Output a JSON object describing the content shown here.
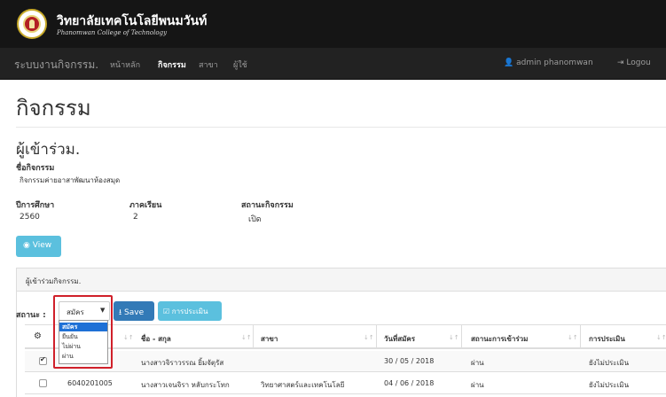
{
  "header": {
    "brand_th": "วิทยาลัยเทคโนโลยีพนมวันท์",
    "brand_en": "Phanomwan College of Technology"
  },
  "navbar": {
    "title": "ระบบงานกิจกรรม.",
    "items": [
      {
        "label": "หน้าหลัก",
        "active": false
      },
      {
        "label": "กิจกรรม",
        "active": true
      },
      {
        "label": "สาขา",
        "active": false
      },
      {
        "label": "ผู้ใช้",
        "active": false
      }
    ],
    "user": "admin phanomwan",
    "logout": "Logou"
  },
  "page": {
    "title": "กิจกรรม",
    "section_title": "ผู้เข้าร่วม.",
    "activity_label": "ชื่อกิจกรรม",
    "activity_value": "กิจกรรมค่ายอาสาพัฒนาห้องสมุด",
    "year_label": "ปีการศึกษา",
    "year_value": "2560",
    "term_label": "ภาคเรียน",
    "term_value": "2",
    "status_label": "สถานะกิจกรรม",
    "status_value": "เปิด",
    "view_button": "View"
  },
  "panel": {
    "heading": "ผู้เข้าร่วมกิจกรรม.",
    "status_label": "สถานะ :",
    "select_value": "สมัคร",
    "dropdown_options": [
      "สมัคร",
      "ยืนยัน",
      "ไม่ผ่าน",
      "ผ่าน"
    ],
    "save_button": "Save",
    "evaluate_button": "การประเมิน"
  },
  "table": {
    "columns": [
      "ชื่อ - สกุล",
      "สาขา",
      "วันที่สมัคร",
      "สถานะการเข้าร่วม",
      "การประเมิน"
    ],
    "rows": [
      {
        "checked": true,
        "id": "",
        "name": "นางสาวจิราวรรณ ยิ้มจัตุรัส",
        "branch": "",
        "date": "30 / 05 / 2018",
        "status": "ผ่าน",
        "evaluation": "ยังไม่ประเมิน"
      },
      {
        "checked": false,
        "id": "6040201005",
        "name": "นางสาวเจนจิรา หลับกระโทก",
        "branch": "วิทยาศาสตร์และเทคโนโลยี",
        "date": "04 / 06 / 2018",
        "status": "ผ่าน",
        "evaluation": "ยังไม่ประเมิน"
      }
    ]
  },
  "colors": {
    "topbar": "#151515",
    "navbar": "#222222",
    "primary": "#337ab7",
    "info": "#5bc0de",
    "highlight": "#d0202a"
  }
}
